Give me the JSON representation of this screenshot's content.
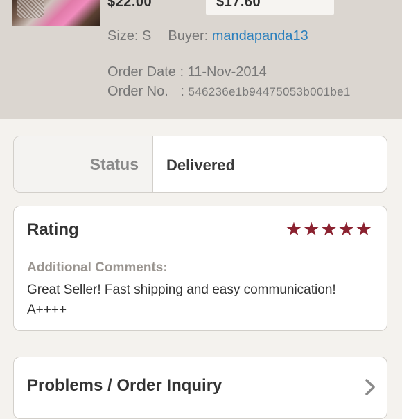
{
  "order_summary": {
    "listing_price": "$22.00",
    "earnings": "$17.60",
    "size_label": "Size: S",
    "buyer_label": "Buyer:",
    "buyer_name": "mandapanda13",
    "order_date_label": "Order Date : ",
    "order_date": "11-Nov-2014",
    "order_no_label": "Order No.",
    "order_no_sep": " : ",
    "order_no": "546236e1b94475053b001be1"
  },
  "status": {
    "label": "Status",
    "value": "Delivered"
  },
  "rating": {
    "title": "Rating",
    "stars": 5,
    "star_color": "#8b2230",
    "comments_label": "Additional Comments:",
    "comments": "Great Seller! Fast shipping and easy communication! A++++"
  },
  "problems": {
    "label": "Problems / Order Inquiry",
    "icon": "chevron-right-icon"
  }
}
